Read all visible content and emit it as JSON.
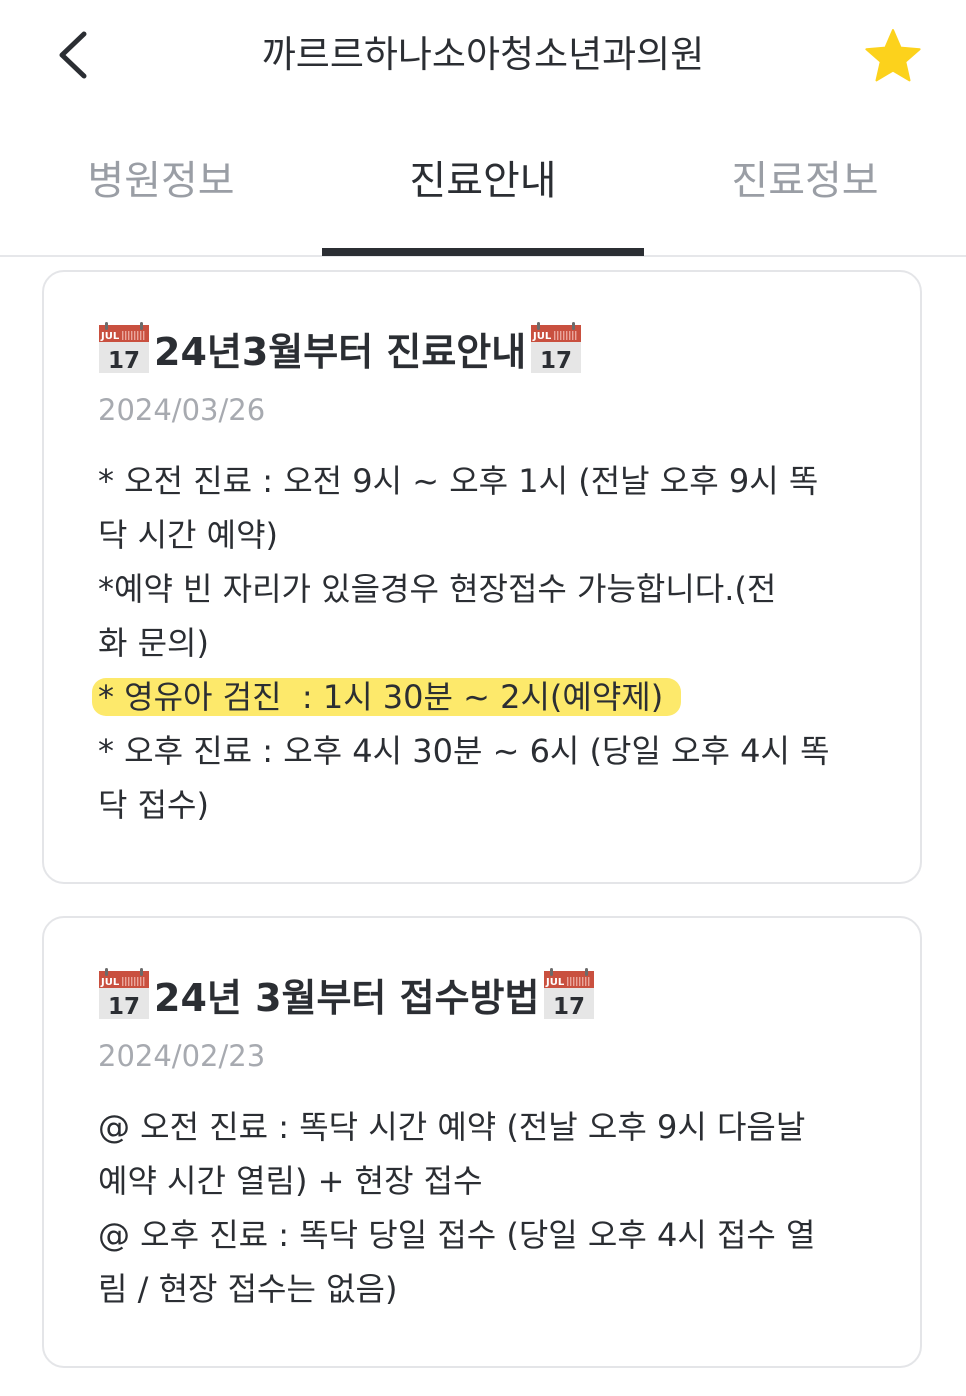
{
  "header": {
    "title": "까르르하나소아청소년과의원",
    "back_icon": "chevron-left-icon",
    "favorite_icon": "star-icon",
    "favorite_color": "#fcd21c"
  },
  "tabs": [
    {
      "label": "병원정보",
      "active": false
    },
    {
      "label": "진료안내",
      "active": true
    },
    {
      "label": "진료정보",
      "active": false
    }
  ],
  "notices": [
    {
      "icon": "calendar-icon",
      "title": "24년3월부터 진료안내",
      "date": "2024/03/26",
      "lines": [
        "* 오전 진료 : 오전 9시 ~ 오후 1시 (전날 오후 9시 똑",
        "닥 시간 예약)",
        "*예약 빈 자리가 있을경우 현장접수 가능합니다.(전",
        "화 문의)",
        "* 영유아 검진  : 1시 30분 ~ 2시(예약제)",
        "* 오후 진료 : 오후 4시 30분 ~ 6시 (당일 오후 4시 똑",
        "닥 접수)"
      ],
      "highlight_line": 4,
      "highlight_color": "#fde96b"
    },
    {
      "icon": "calendar-icon",
      "title": "24년 3월부터 접수방법",
      "date": "2024/02/23",
      "lines": [
        "@ 오전 진료 : 똑닥 시간 예약 (전날 오후 9시 다음날",
        "예약 시간 열림) + 현장 접수",
        "@ 오후 진료 : 똑닥 당일 접수 (당일 오후 4시 접수 열",
        "림 / 현장 접수는 없음)"
      ]
    }
  ],
  "calendar_icon": {
    "month": "JUL",
    "day": "17"
  }
}
